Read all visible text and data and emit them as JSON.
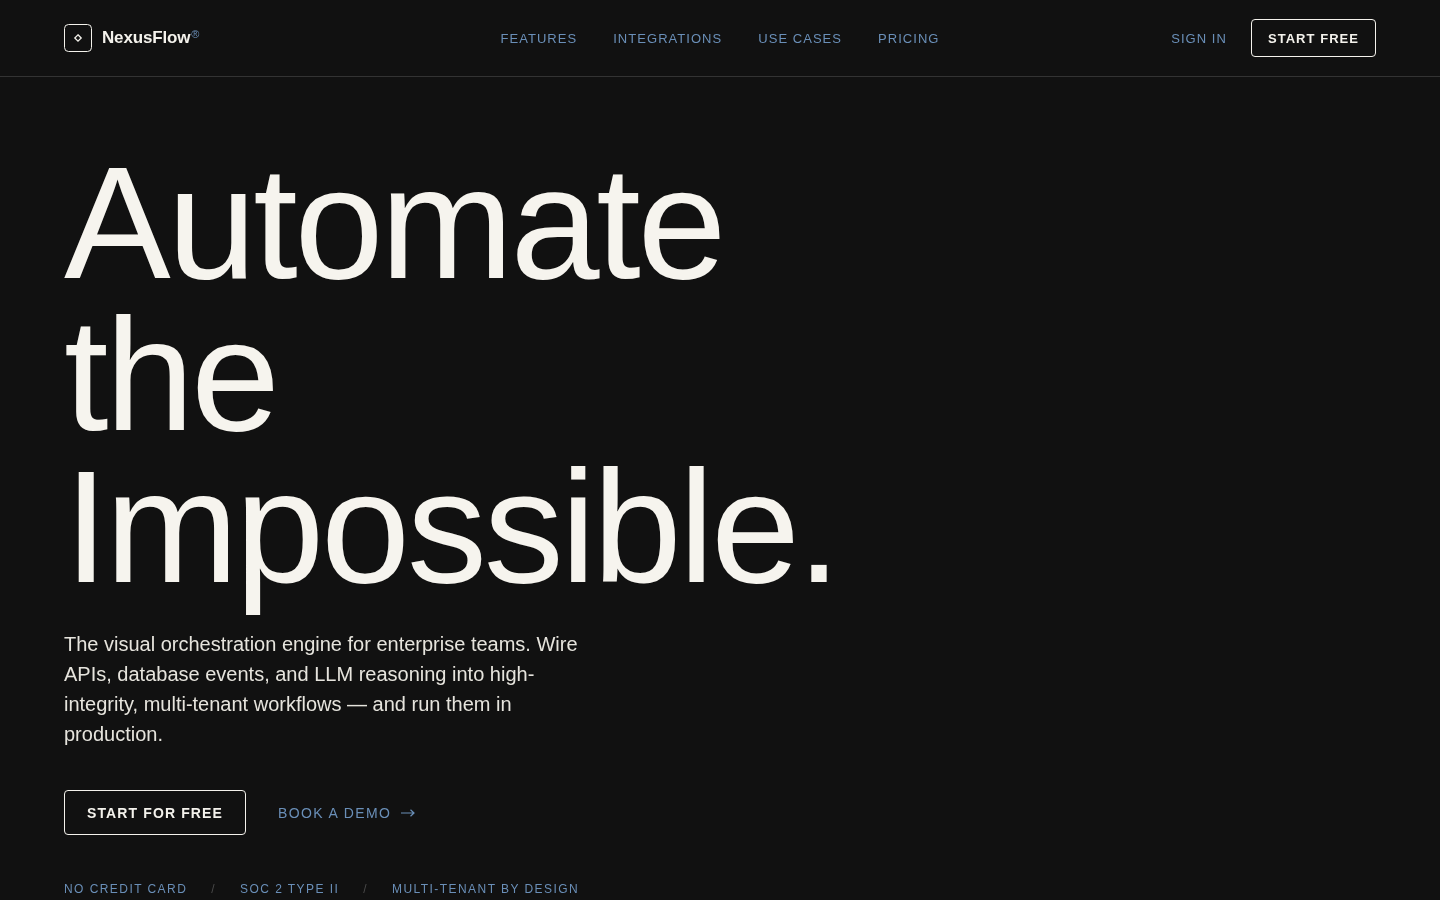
{
  "header": {
    "logo": {
      "name": "NexusFlow",
      "mark": "®"
    },
    "nav": [
      "FEATURES",
      "INTEGRATIONS",
      "USE CASES",
      "PRICING"
    ],
    "sign_in": "SIGN IN",
    "cta": "START FREE"
  },
  "hero": {
    "headline": "Automate the Impossible.",
    "description": "The visual orchestration engine for enterprise teams. Wire APIs, database events, and LLM reasoning into high-integrity, multi-tenant workflows — and run them in production.",
    "primary_button": "START FOR FREE",
    "secondary_link": "BOOK A DEMO",
    "trust_items": [
      {
        "kind": "label",
        "text": "NO CREDIT CARD"
      },
      {
        "kind": "separator",
        "text": "/"
      },
      {
        "kind": "label",
        "text": "SOC 2 TYPE II"
      },
      {
        "kind": "separator",
        "text": "/"
      },
      {
        "kind": "label",
        "text": "MULTI-TENANT BY DESIGN"
      }
    ]
  }
}
